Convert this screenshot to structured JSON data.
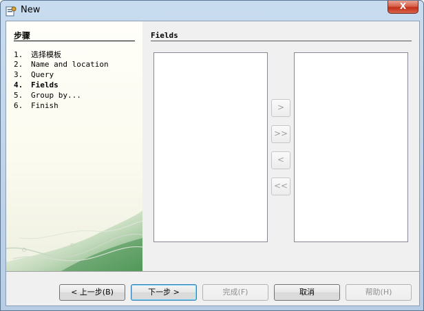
{
  "window": {
    "title": "New",
    "close_label": "X"
  },
  "steps": {
    "heading": "步骤",
    "items": [
      {
        "num": "1.",
        "label": "选择模板"
      },
      {
        "num": "2.",
        "label": "Name and location"
      },
      {
        "num": "3.",
        "label": "Query"
      },
      {
        "num": "4.",
        "label": "Fields"
      },
      {
        "num": "5.",
        "label": "Group by..."
      },
      {
        "num": "6.",
        "label": "Finish"
      }
    ],
    "active_index": 3
  },
  "content": {
    "heading": "Fields",
    "move_buttons": [
      ">",
      ">>",
      "<",
      "<<"
    ]
  },
  "footer": {
    "back": "< 上一步(B)",
    "next": "下一步 >",
    "finish": "完成(F)",
    "cancel": "取消",
    "help": "帮助(H)"
  },
  "colors": {
    "titlebar": "#b7cde6",
    "close": "#c2301a",
    "panel": "#f0f0f0",
    "steps_bg": "#fbfbef",
    "deco_green": "#5fa464"
  }
}
